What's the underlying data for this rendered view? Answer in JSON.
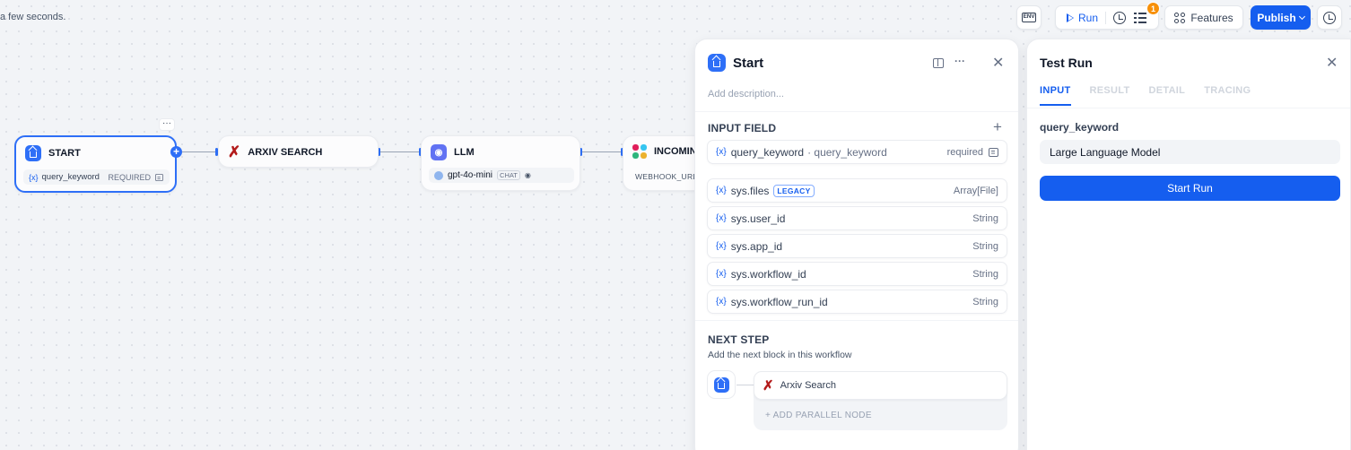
{
  "autosave_text": "a few seconds.",
  "toolbar": {
    "env_label": "ENV",
    "run_label": "Run",
    "checklist_badge": "1",
    "features_label": "Features",
    "publish_label": "Publish"
  },
  "canvas": {
    "nodes": [
      {
        "title": "START",
        "var": "query_keyword",
        "tag": "REQUIRED"
      },
      {
        "title": "ARXIV SEARCH"
      },
      {
        "title": "LLM",
        "model": "gpt-4o-mini",
        "mode": "CHAT"
      },
      {
        "title": "INCOMING",
        "field": "WEBHOOK_URL"
      }
    ],
    "more_dots": "···",
    "var_symbol": "{x}"
  },
  "start_panel": {
    "title": "Start",
    "more": "···",
    "description_placeholder": "Add description...",
    "input_field_heading": "INPUT FIELD",
    "add_symbol": "+",
    "input_fields": [
      {
        "name": "query_keyword",
        "label": "· query_keyword",
        "right": "required"
      }
    ],
    "system_vars": [
      {
        "name": "sys.files",
        "badge": "LEGACY",
        "type": "Array[File]"
      },
      {
        "name": "sys.user_id",
        "type": "String"
      },
      {
        "name": "sys.app_id",
        "type": "String"
      },
      {
        "name": "sys.workflow_id",
        "type": "String"
      },
      {
        "name": "sys.workflow_run_id",
        "type": "String"
      }
    ],
    "next_step_heading": "NEXT STEP",
    "next_step_sub": "Add the next block in this workflow",
    "next_node": "Arxiv Search",
    "add_parallel": "+ ADD PARALLEL NODE"
  },
  "test_run": {
    "title": "Test Run",
    "tabs": [
      "INPUT",
      "RESULT",
      "DETAIL",
      "TRACING"
    ],
    "field_label": "query_keyword",
    "field_value": "Large Language Model",
    "start_button": "Start Run"
  },
  "colors": {
    "accent": "#155eef",
    "node_icon_blue": "#2e6ff7",
    "badge_orange": "#f79009",
    "arxiv_red": "#b31b1b"
  }
}
